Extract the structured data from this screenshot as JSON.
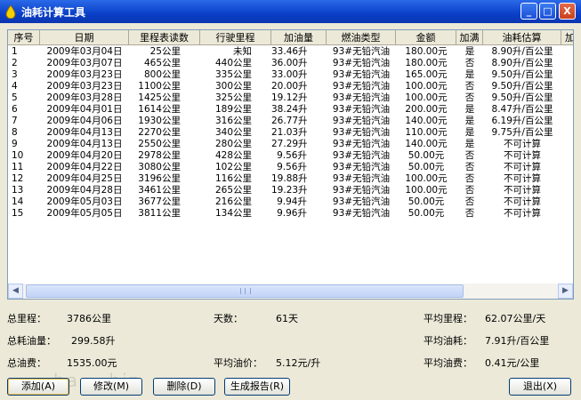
{
  "window": {
    "title": "油耗计算工具",
    "min": "_",
    "max": "□",
    "close": "X"
  },
  "table": {
    "columns": [
      "序号",
      "日期",
      "里程表读数",
      "行驶里程",
      "加油量",
      "燃油类型",
      "金额",
      "加满",
      "油耗估算",
      "加"
    ],
    "rows": [
      [
        "1",
        "2009年03月04日",
        "25公里",
        "未知",
        "33.46升",
        "93#无铅汽油",
        "180.00元",
        "是",
        "8.90升/百公里"
      ],
      [
        "2",
        "2009年03月07日",
        "465公里",
        "440公里",
        "36.00升",
        "93#无铅汽油",
        "180.00元",
        "否",
        "8.90升/百公里"
      ],
      [
        "3",
        "2009年03月23日",
        "800公里",
        "335公里",
        "33.00升",
        "93#无铅汽油",
        "165.00元",
        "是",
        "9.50升/百公里"
      ],
      [
        "4",
        "2009年03月23日",
        "1100公里",
        "300公里",
        "20.00升",
        "93#无铅汽油",
        "100.00元",
        "否",
        "9.50升/百公里"
      ],
      [
        "5",
        "2009年03月28日",
        "1425公里",
        "325公里",
        "19.12升",
        "93#无铅汽油",
        "100.00元",
        "否",
        "9.50升/百公里"
      ],
      [
        "6",
        "2009年04月01日",
        "1614公里",
        "189公里",
        "38.24升",
        "93#无铅汽油",
        "200.00元",
        "是",
        "8.47升/百公里"
      ],
      [
        "7",
        "2009年04月06日",
        "1930公里",
        "316公里",
        "26.77升",
        "93#无铅汽油",
        "140.00元",
        "是",
        "6.19升/百公里"
      ],
      [
        "8",
        "2009年04月13日",
        "2270公里",
        "340公里",
        "21.03升",
        "93#无铅汽油",
        "110.00元",
        "是",
        "9.75升/百公里"
      ],
      [
        "9",
        "2009年04月13日",
        "2550公里",
        "280公里",
        "27.29升",
        "93#无铅汽油",
        "140.00元",
        "是",
        "不可计算"
      ],
      [
        "10",
        "2009年04月20日",
        "2978公里",
        "428公里",
        "9.56升",
        "93#无铅汽油",
        "50.00元",
        "否",
        "不可计算"
      ],
      [
        "11",
        "2009年04月22日",
        "3080公里",
        "102公里",
        "9.56升",
        "93#无铅汽油",
        "50.00元",
        "否",
        "不可计算"
      ],
      [
        "12",
        "2009年04月25日",
        "3196公里",
        "116公里",
        "19.88升",
        "93#无铅汽油",
        "100.00元",
        "否",
        "不可计算"
      ],
      [
        "13",
        "2009年04月28日",
        "3461公里",
        "265公里",
        "19.23升",
        "93#无铅汽油",
        "100.00元",
        "否",
        "不可计算"
      ],
      [
        "14",
        "2009年05月03日",
        "3677公里",
        "216公里",
        "9.94升",
        "93#无铅汽油",
        "50.00元",
        "否",
        "不可计算"
      ],
      [
        "15",
        "2009年05月05日",
        "3811公里",
        "134公里",
        "9.96升",
        "93#无铅汽油",
        "50.00元",
        "否",
        "不可计算"
      ]
    ]
  },
  "stats": {
    "total_mileage_label": "总里程：",
    "total_mileage": "3786公里",
    "days_label": "天数：",
    "days": "61天",
    "avg_mileage_label": "平均里程：",
    "avg_mileage": "62.07公里/天",
    "total_fuel_label": "总耗油量：",
    "total_fuel": "299.58升",
    "avg_consumption_label": "平均油耗：",
    "avg_consumption": "7.91升/百公里",
    "total_cost_label": "总油费：",
    "total_cost": "1535.00元",
    "avg_price_label": "平均油价：",
    "avg_price": "5.12元/升",
    "avg_cost_label": "平均油费：",
    "avg_cost": "0.41元/公里"
  },
  "buttons": {
    "add": "添加(A)",
    "edit": "修改(M)",
    "delete": "删除(D)",
    "report": "生成报告(R)",
    "exit": "退出(X)"
  },
  "watermark": "ba··· biz"
}
